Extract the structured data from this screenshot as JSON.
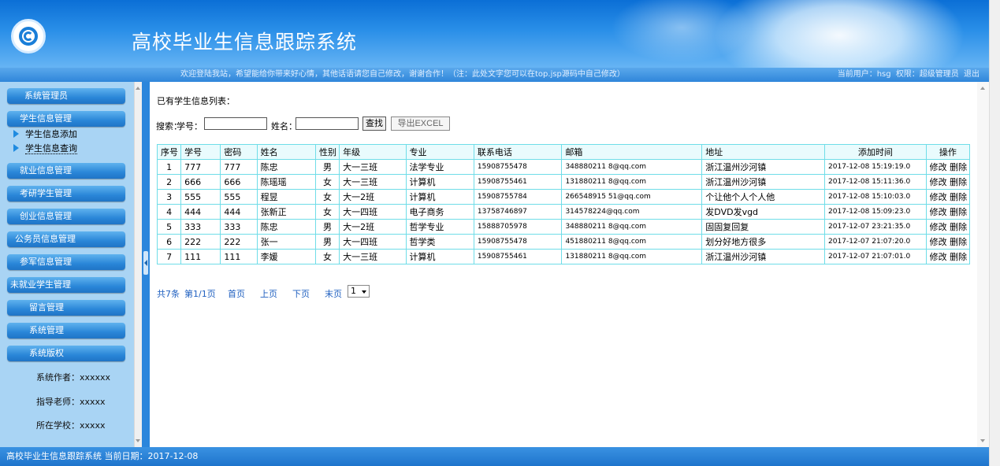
{
  "header": {
    "title": "高校毕业生信息跟踪系统"
  },
  "infobar": {
    "welcome": "欢迎登陆我站，希望能给你带来好心情，其他话语请您自己修改，谢谢合作！（注：此处文字您可以在top.jsp源码中自己修改）",
    "user_label": "当前用户：hsg",
    "role_label": "权限：超级管理员",
    "logout": "退出"
  },
  "sidebar": {
    "menus": [
      {
        "label": "系统管理员"
      },
      {
        "label": "学生信息管理"
      },
      {
        "label": "就业信息管理"
      },
      {
        "label": "考研学生管理"
      },
      {
        "label": "创业信息管理"
      },
      {
        "label": "公务员信息管理"
      },
      {
        "label": "参军信息管理"
      },
      {
        "label": "未就业学生管理"
      },
      {
        "label": "留言管理"
      },
      {
        "label": "系统管理"
      },
      {
        "label": "系统版权"
      }
    ],
    "submenu": [
      {
        "label": "学生信息添加"
      },
      {
        "label": "学生信息查询"
      }
    ],
    "credits": {
      "author": "系统作者：xxxxxx",
      "teacher": "指导老师：xxxxx",
      "school": "所在学校：xxxxx"
    }
  },
  "main": {
    "list_title": "已有学生信息列表：",
    "search": {
      "label": "搜索：",
      "student_no_label": "学号：",
      "student_no_value": "",
      "name_label": "姓名：",
      "name_value": "",
      "search_button": "查找",
      "export_button": "导出EXCEL"
    },
    "table": {
      "headers": [
        "序号",
        "学号",
        "密码",
        "姓名",
        "性别",
        "年级",
        "专业",
        "联系电话",
        "邮箱",
        "地址",
        "添加时间",
        "操作"
      ],
      "rows": [
        {
          "seq": "1",
          "no": "777",
          "pwd": "777",
          "name": "陈忠",
          "gender": "男",
          "grade": "大一三班",
          "major": "法学专业",
          "phone": "15908755478",
          "email": "348880211 8@qq.com",
          "address": "浙江温州沙河镇",
          "time": "2017-12-08 15:19:19.0"
        },
        {
          "seq": "2",
          "no": "666",
          "pwd": "666",
          "name": "陈瑶瑶",
          "gender": "女",
          "grade": "大一三班",
          "major": "计算机",
          "phone": "15908755461",
          "email": "131880211 8@qq.com",
          "address": "浙江温州沙河镇",
          "time": "2017-12-08 15:11:36.0"
        },
        {
          "seq": "3",
          "no": "555",
          "pwd": "555",
          "name": "程昱",
          "gender": "女",
          "grade": "大一2班",
          "major": "计算机",
          "phone": "15908755784",
          "email": "266548915 51@qq.com",
          "address": "个让他个人个人他",
          "time": "2017-12-08 15:10:03.0"
        },
        {
          "seq": "4",
          "no": "444",
          "pwd": "444",
          "name": "张新正",
          "gender": "女",
          "grade": "大一四班",
          "major": "电子商务",
          "phone": "13758746897",
          "email": "314578224@qq.com",
          "address": "发DVD发vgd",
          "time": "2017-12-08 15:09:23.0"
        },
        {
          "seq": "5",
          "no": "333",
          "pwd": "333",
          "name": "陈忠",
          "gender": "男",
          "grade": "大一2班",
          "major": "哲学专业",
          "phone": "15888705978",
          "email": "348880211 8@qq.com",
          "address": "固固复回复",
          "time": "2017-12-07 23:21:35.0"
        },
        {
          "seq": "6",
          "no": "222",
          "pwd": "222",
          "name": "张一",
          "gender": "男",
          "grade": "大一四班",
          "major": "哲学类",
          "phone": "15908755478",
          "email": "451880211 8@qq.com",
          "address": "划分好地方很多",
          "time": "2017-12-07 21:07:20.0"
        },
        {
          "seq": "7",
          "no": "111",
          "pwd": "111",
          "name": "李媛",
          "gender": "女",
          "grade": "大一三班",
          "major": "计算机",
          "phone": "15908755461",
          "email": "131880211 8@qq.com",
          "address": "浙江温州沙河镇",
          "time": "2017-12-07 21:07:01.0"
        }
      ],
      "edit_label": "修改",
      "delete_label": "删除"
    },
    "pager": {
      "total": "共7条",
      "page": "第1/1页",
      "first": "首页",
      "prev": "上页",
      "next": "下页",
      "last": "末页",
      "selected_page": "1"
    }
  },
  "footer": {
    "text": "高校毕业生信息跟踪系统 当前日期：2017-12-08"
  },
  "colors": {
    "header_blue": "#0b6fd6",
    "sidebar_bg": "#a9d4f4",
    "table_border": "#6fdde8",
    "link_blue": "#2060c0"
  }
}
